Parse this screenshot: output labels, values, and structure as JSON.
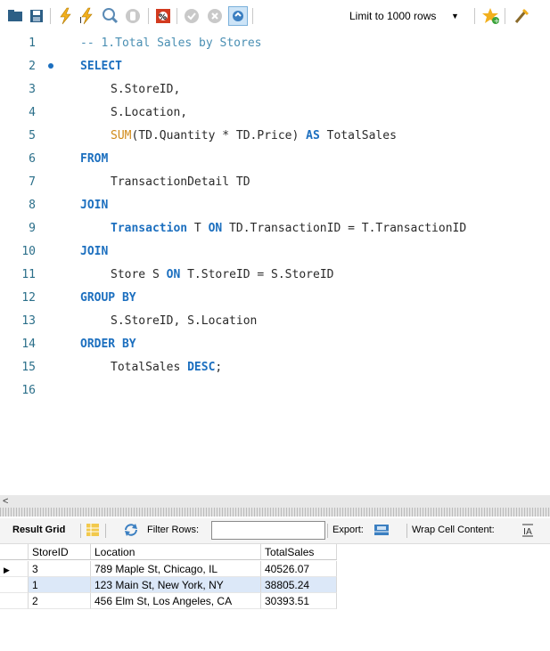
{
  "toolbar": {
    "buttons": [
      "open-folder-icon",
      "save-icon",
      "execute-icon",
      "execute-current-icon",
      "explain-icon",
      "stop-icon",
      "toggle-continue-icon",
      "commit-icon",
      "rollback-icon",
      "autocommit-icon",
      "add-snippet-icon",
      "beautify-icon"
    ],
    "limit_label": "Limit to 1000 rows",
    "accent": "#f2b01e"
  },
  "editor": {
    "lines": [
      {
        "n": "1",
        "indent": 0,
        "tokens": [
          {
            "t": "-- 1.Total Sales by Stores",
            "c": "cm"
          }
        ]
      },
      {
        "n": "2",
        "indent": 0,
        "dot": true,
        "tokens": [
          {
            "t": "SELECT",
            "c": "kw"
          }
        ]
      },
      {
        "n": "3",
        "indent": 1,
        "tokens": [
          {
            "t": "S.StoreID,",
            "c": "tx"
          }
        ]
      },
      {
        "n": "4",
        "indent": 1,
        "tokens": [
          {
            "t": "S.Location,",
            "c": "tx"
          }
        ]
      },
      {
        "n": "5",
        "indent": 1,
        "tokens": [
          {
            "t": "SUM",
            "c": "fn"
          },
          {
            "t": "(TD.Quantity * TD.Price) ",
            "c": "tx"
          },
          {
            "t": "AS",
            "c": "kw"
          },
          {
            "t": " TotalSales",
            "c": "tx"
          }
        ]
      },
      {
        "n": "6",
        "indent": 0,
        "tokens": [
          {
            "t": "FROM",
            "c": "kw"
          }
        ]
      },
      {
        "n": "7",
        "indent": 1,
        "tokens": [
          {
            "t": "TransactionDetail TD",
            "c": "tx"
          }
        ]
      },
      {
        "n": "8",
        "indent": 0,
        "tokens": [
          {
            "t": "JOIN",
            "c": "kw"
          }
        ]
      },
      {
        "n": "9",
        "indent": 1,
        "tokens": [
          {
            "t": "Transaction",
            "c": "kw"
          },
          {
            "t": " T ",
            "c": "tx"
          },
          {
            "t": "ON",
            "c": "kw"
          },
          {
            "t": " TD.TransactionID = T.TransactionID",
            "c": "tx"
          }
        ]
      },
      {
        "n": "10",
        "indent": 0,
        "tokens": [
          {
            "t": "JOIN",
            "c": "kw"
          }
        ]
      },
      {
        "n": "11",
        "indent": 1,
        "tokens": [
          {
            "t": "Store S ",
            "c": "tx"
          },
          {
            "t": "ON",
            "c": "kw"
          },
          {
            "t": " T.StoreID = S.StoreID",
            "c": "tx"
          }
        ]
      },
      {
        "n": "12",
        "indent": 0,
        "tokens": [
          {
            "t": "GROUP BY",
            "c": "kw"
          }
        ]
      },
      {
        "n": "13",
        "indent": 1,
        "tokens": [
          {
            "t": "S.StoreID, S.Location",
            "c": "tx"
          }
        ]
      },
      {
        "n": "14",
        "indent": 0,
        "tokens": [
          {
            "t": "ORDER BY",
            "c": "kw"
          }
        ]
      },
      {
        "n": "15",
        "indent": 1,
        "tokens": [
          {
            "t": "TotalSales ",
            "c": "tx"
          },
          {
            "t": "DESC",
            "c": "kw"
          },
          {
            "t": ";",
            "c": "tx"
          }
        ]
      },
      {
        "n": "16",
        "indent": 0,
        "tokens": []
      }
    ]
  },
  "results": {
    "tab_label": "Result Grid",
    "filter_label": "Filter Rows:",
    "filter_value": "",
    "export_label": "Export:",
    "wrap_label": "Wrap Cell Content:",
    "columns": [
      "StoreID",
      "Location",
      "TotalSales"
    ],
    "rows": [
      [
        "3",
        "789 Maple St, Chicago, IL",
        "40526.07"
      ],
      [
        "1",
        "123 Main St, New York, NY",
        "38805.24"
      ],
      [
        "2",
        "456 Elm St, Los Angeles, CA",
        "30393.51"
      ]
    ],
    "selected_row": 1
  }
}
